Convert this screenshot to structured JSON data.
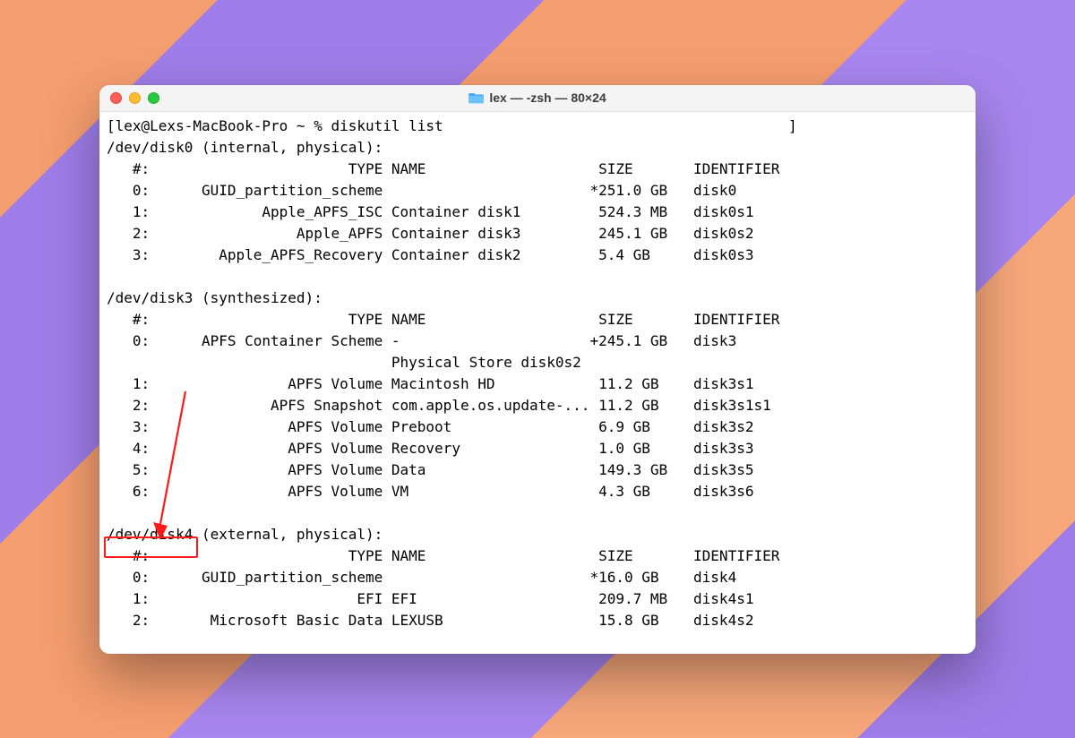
{
  "window": {
    "title": "lex — -zsh — 80×24"
  },
  "prompt": "[lex@Lexs-MacBook-Pro ~ % diskutil list",
  "disks": [
    {
      "header": "/dev/disk0 (internal, physical):",
      "col_header": "   #:                       TYPE NAME                    SIZE       IDENTIFIER",
      "rows": [
        "   0:      GUID_partition_scheme                        *251.0 GB   disk0",
        "   1:             Apple_APFS_ISC Container disk1         524.3 MB   disk0s1",
        "   2:                 Apple_APFS Container disk3         245.1 GB   disk0s2",
        "   3:        Apple_APFS_Recovery Container disk2         5.4 GB     disk0s3"
      ]
    },
    {
      "header": "/dev/disk3 (synthesized):",
      "col_header": "   #:                       TYPE NAME                    SIZE       IDENTIFIER",
      "rows": [
        "   0:      APFS Container Scheme -                      +245.1 GB   disk3",
        "                                 Physical Store disk0s2",
        "   1:                APFS Volume Macintosh HD            11.2 GB    disk3s1",
        "   2:              APFS Snapshot com.apple.os.update-... 11.2 GB    disk3s1s1",
        "   3:                APFS Volume Preboot                 6.9 GB     disk3s2",
        "   4:                APFS Volume Recovery                1.0 GB     disk3s3",
        "   5:                APFS Volume Data                    149.3 GB   disk3s5",
        "   6:                APFS Volume VM                      4.3 GB     disk3s6"
      ]
    },
    {
      "header_device": "/dev/disk4",
      "header_rest": " (external, physical):",
      "col_header": "   #:                       TYPE NAME                    SIZE       IDENTIFIER",
      "rows": [
        "   0:      GUID_partition_scheme                        *16.0 GB    disk4",
        "   1:                        EFI EFI                     209.7 MB   disk4s1",
        "   2:       Microsoft Basic Data LEXUSB                  15.8 GB    disk4s2"
      ]
    }
  ],
  "annotation": {
    "highlight_target": "/dev/disk4",
    "color": "#ff1a1a"
  }
}
